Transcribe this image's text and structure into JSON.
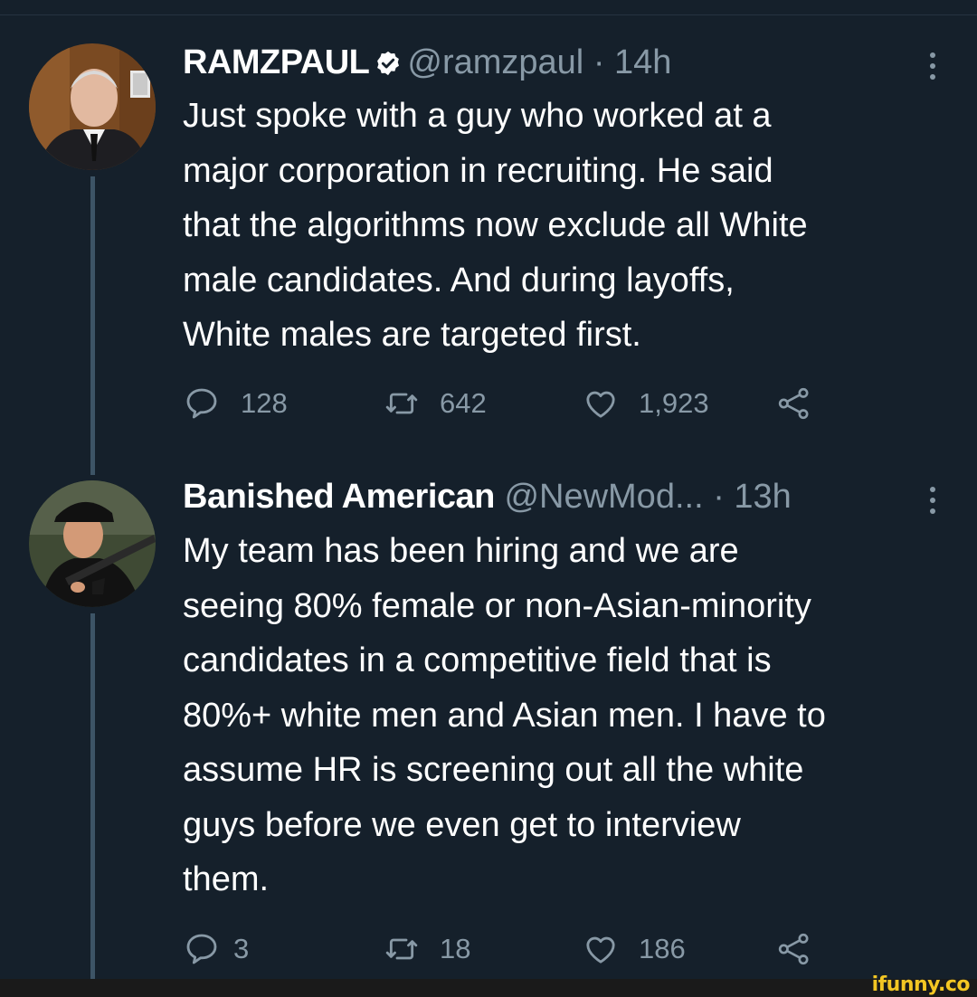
{
  "tweets": [
    {
      "name": "RAMZPAUL",
      "handle": "@ramzpaul",
      "time": "· 14h",
      "verified": true,
      "text": "Just spoke with a guy who worked at a\nmajor corporation in recruiting. He said\nthat the algorithms now exclude all White\nmale candidates. And during layoffs,\nWhite males are targeted first.",
      "replies": "128",
      "retweets": "642",
      "likes": "1,923"
    },
    {
      "name": "Banished American",
      "handle": "@NewMod...",
      "time": "· 13h",
      "verified": false,
      "text": "My team has been hiring and we are\nseeing 80% female or non-Asian-minority\ncandidates in a competitive field that is\n80%+ white men and Asian men. I have to\nassume HR is screening out all the white\nguys before we even get to interview\nthem.",
      "replies": "3",
      "retweets": "18",
      "likes": "186"
    }
  ],
  "watermark": "ifunny.co",
  "colors": {
    "background": "#15202b",
    "secondary_text": "#8899a6",
    "thread_line": "#3d5466",
    "watermark": "#f3c623"
  }
}
